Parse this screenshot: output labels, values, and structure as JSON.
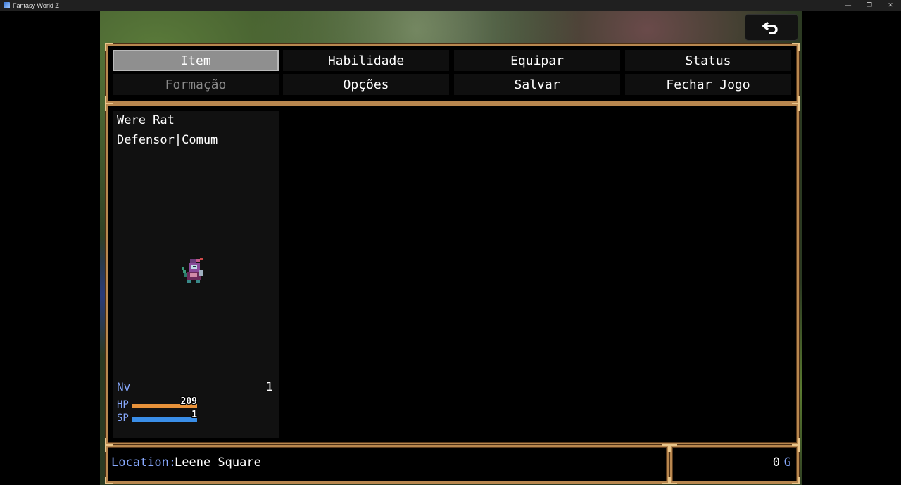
{
  "window": {
    "title": "Fantasy World Z",
    "minimize": "—",
    "maximize": "❐",
    "close": "✕"
  },
  "menu": {
    "commands": [
      {
        "label": "Item",
        "state": "selected"
      },
      {
        "label": "Habilidade",
        "state": "enabled"
      },
      {
        "label": "Equipar",
        "state": "enabled"
      },
      {
        "label": "Status",
        "state": "enabled"
      },
      {
        "label": "Formação",
        "state": "disabled"
      },
      {
        "label": "Opções",
        "state": "enabled"
      },
      {
        "label": "Salvar",
        "state": "enabled"
      },
      {
        "label": "Fechar Jogo",
        "state": "enabled"
      }
    ]
  },
  "actor": {
    "name": "Were Rat",
    "class": "Defensor|Comum",
    "level_label": "Nv",
    "level": "1",
    "hp_label": "HP",
    "hp_value": "209",
    "hp_fraction": 1.0,
    "hp_color": "#e8923a",
    "sp_label": "SP",
    "sp_value": "1",
    "sp_fraction": 1.0,
    "sp_color": "#3a8ee8"
  },
  "location": {
    "label": "Location:",
    "value": "Leene Square"
  },
  "gold": {
    "value": "0",
    "unit": "G"
  },
  "colors": {
    "frame": "#b8874f",
    "system_text": "#88aaff"
  }
}
